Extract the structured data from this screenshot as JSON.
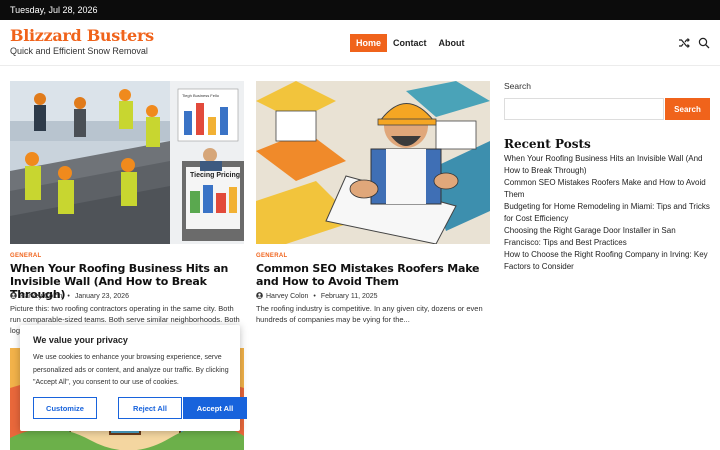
{
  "topbar": {
    "date": "Tuesday, Jul 28, 2026"
  },
  "header": {
    "title": "Blizzard Busters",
    "tagline": "Quick and Efficient Snow Removal",
    "nav": [
      {
        "label": "Home",
        "active": true
      },
      {
        "label": "Contact"
      },
      {
        "label": "About"
      }
    ],
    "icons": [
      "shuffle-icon",
      "search-icon"
    ]
  },
  "posts": [
    {
      "category": "GENERAL",
      "title": "When Your Roofing Business Hits an Invisible Wall (And How to Break Through)",
      "author": "Harvey Colon",
      "date": "January 23, 2026",
      "excerpt": "Picture this: two roofing contractors operating in the same city. Both run comparable-sized teams. Both serve similar neighborhoods. Both log",
      "thumb_text": {
        "laptop": "Tiecing Pricing",
        "tablet": "Tiegh Business Fello"
      }
    },
    {
      "category": "GENERAL",
      "title": "Common SEO Mistakes Roofers Make and How to Avoid Them",
      "author": "Harvey Colon",
      "date": "February 11, 2025",
      "excerpt": "The roofing industry is competitive. In any given city, dozens or even hundreds of companies may be vying for the..."
    }
  ],
  "sidebar": {
    "search_label": "Search",
    "search_button": "Search",
    "recent_title": "Recent Posts",
    "recent": [
      "When Your Roofing Business Hits an Invisible Wall (And How to Break Through)",
      "Common SEO Mistakes Roofers Make and How to Avoid Them",
      "Budgeting for Home Remodeling in Miami: Tips and Tricks for Cost Efficiency",
      "Choosing the Right Garage Door Installer in San Francisco: Tips and Best Practices",
      "How to Choose the Right Roofing Company in Irving: Key Factors to Consider"
    ]
  },
  "cookie": {
    "title": "We value your privacy",
    "text": "We use cookies to enhance your browsing experience, serve personalized ads or content, and analyze our traffic. By clicking \"Accept All\", you consent to our use of cookies.",
    "customize": "Customize",
    "reject": "Reject All",
    "accept": "Accept All"
  },
  "colors": {
    "accent": "#f0631b",
    "cookie_blue": "#1863dc",
    "topbar": "#0c0c0c"
  }
}
